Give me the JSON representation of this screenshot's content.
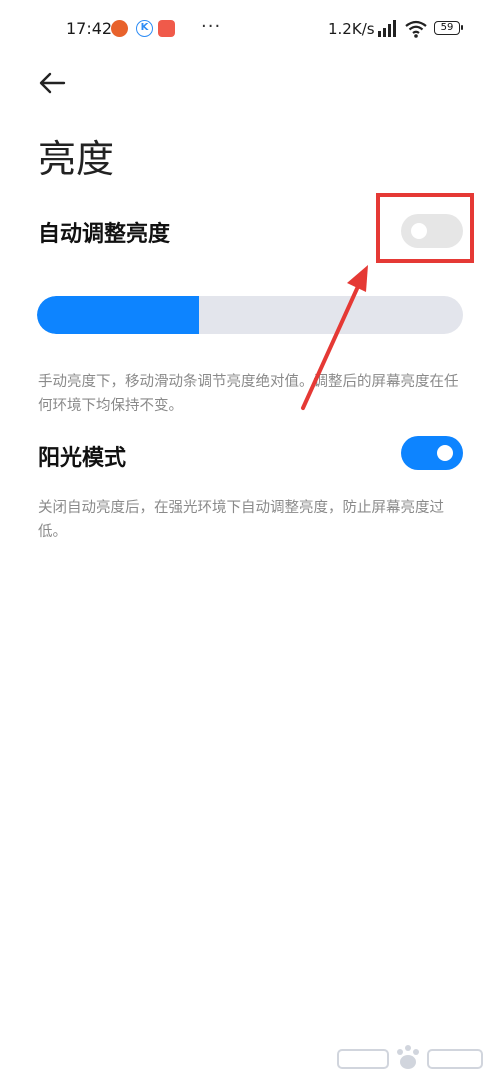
{
  "status_bar": {
    "time": "17:42",
    "dots": "···",
    "net_speed": "1.2K/s",
    "battery": "59"
  },
  "header": {
    "back_icon": "arrow-left-icon",
    "title": "亮度"
  },
  "auto_brightness": {
    "label": "自动调整亮度",
    "enabled": false
  },
  "brightness_slider": {
    "value_percent": 38,
    "description": "手动亮度下，移动滑动条调节亮度绝对值。调整后的屏幕亮度在任何环境下均保持不变。"
  },
  "sunlight_mode": {
    "label": "阳光模式",
    "enabled": true,
    "description": "关闭自动亮度后，在强光环境下自动调整亮度，防止屏幕亮度过低。"
  },
  "annotation": {
    "box_color": "#e53935",
    "arrow_color": "#e53935"
  },
  "colors": {
    "accent": "#0d84ff"
  }
}
